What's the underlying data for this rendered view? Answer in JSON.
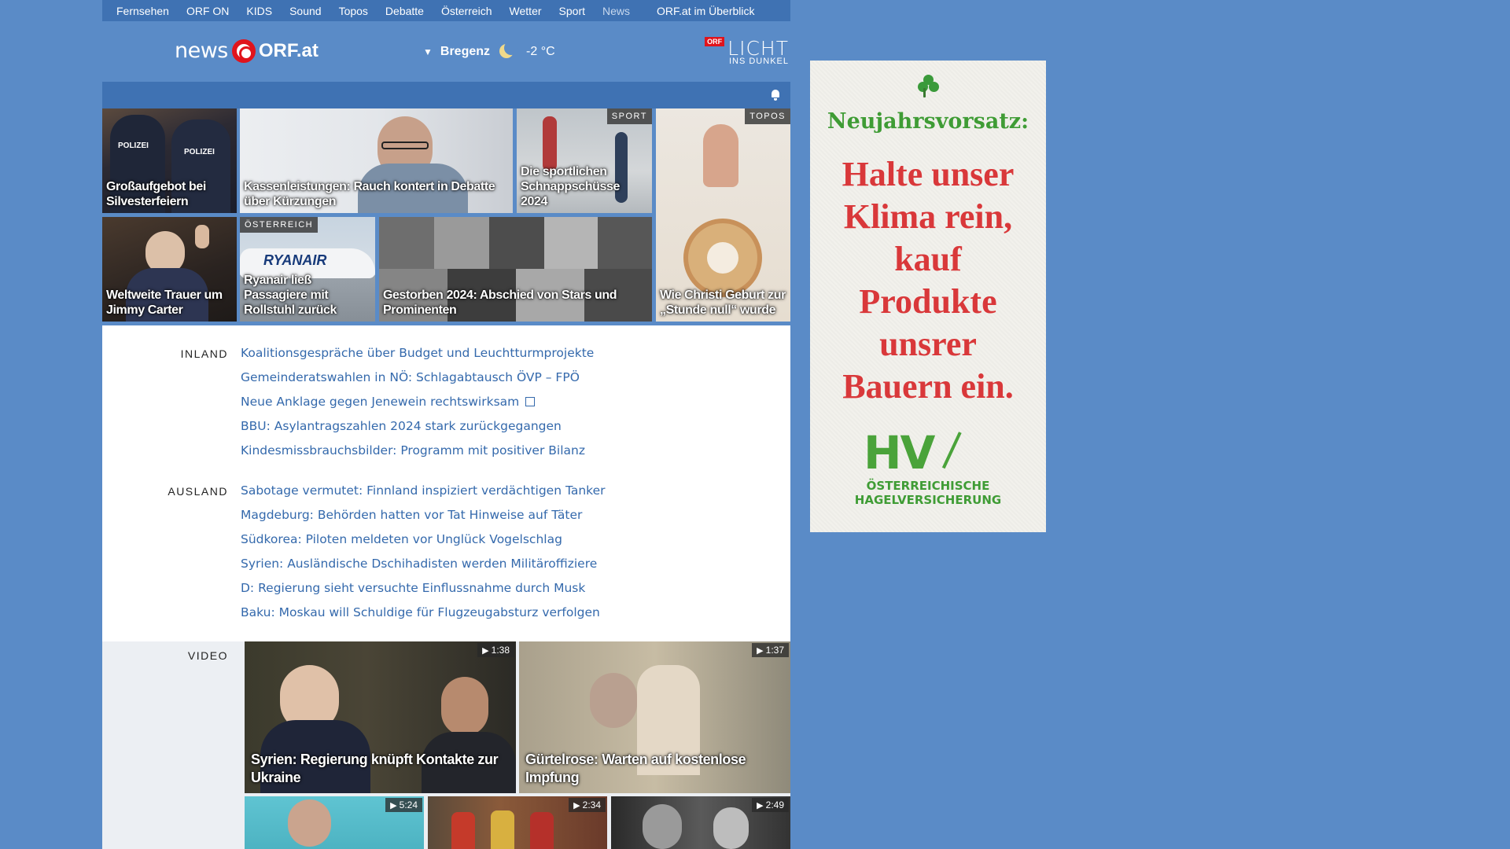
{
  "topnav": {
    "items": [
      "Fernsehen",
      "ORF ON",
      "KIDS",
      "Sound",
      "Topos",
      "Debatte",
      "Österreich",
      "Wetter",
      "Sport",
      "News"
    ],
    "overview": "ORF.at im Überblick"
  },
  "header": {
    "logo_news": "news",
    "logo_orf": "ORF.at",
    "weather_location": "Bregenz",
    "weather_temp": "-2 °C",
    "licht_badge": "ORF",
    "licht_title": "LICHT",
    "licht_subtitle": "INS DUNKEL"
  },
  "tiles": [
    {
      "caption": "Großaufgebot bei Silvesterfeiern",
      "tag": ""
    },
    {
      "caption": "Kassenleistungen: Rauch kontert in Debatte über Kürzungen",
      "tag": ""
    },
    {
      "caption": "Die sportlichen Schnappschüsse 2024",
      "tag": "SPORT"
    },
    {
      "caption": "Wie Christi Geburt zur „Stunde null“ wurde",
      "tag": "TOPOS"
    },
    {
      "caption": "Weltweite Trauer um Jimmy Carter",
      "tag": ""
    },
    {
      "caption": "Ryanair ließ Passagiere mit Rollstuhl zurück",
      "tag": "ÖSTERREICH"
    },
    {
      "caption": "Gestorben 2024: Abschied von Stars und Prominenten",
      "tag": ""
    }
  ],
  "inland": {
    "label": "INLAND",
    "links": [
      "Koalitionsgespräche über Budget und Leuchtturmprojekte",
      "Gemeinderatswahlen in NÖ: Schlagabtausch ÖVP – FPÖ",
      "Neue Anklage gegen Jenewein rechtswirksam",
      "BBU: Asylantragszahlen 2024 stark zurückgegangen",
      "Kindesmissbrauchsbilder: Programm mit positiver Bilanz"
    ]
  },
  "ausland": {
    "label": "AUSLAND",
    "links": [
      "Sabotage vermutet: Finnland inspiziert verdächtigen Tanker",
      "Magdeburg: Behörden hatten vor Tat Hinweise auf Täter",
      "Südkorea: Piloten meldeten vor Unglück Vogelschlag",
      "Syrien: Ausländische Dschihadisten werden Militäroffiziere",
      "D: Regierung sieht versuchte Einflussnahme durch Musk",
      "Baku: Moskau will Schuldige für Flugzeugabsturz verfolgen"
    ]
  },
  "video": {
    "label": "VIDEO",
    "items": [
      {
        "caption": "Syrien: Regierung knüpft Kontakte zur Ukraine",
        "duration": "1:38"
      },
      {
        "caption": "Gürtelrose: Warten auf kostenlose Impfung",
        "duration": "1:37"
      },
      {
        "caption": "",
        "duration": "5:24"
      },
      {
        "caption": "",
        "duration": "2:34"
      },
      {
        "caption": "",
        "duration": "2:49"
      }
    ]
  },
  "ad": {
    "headline": "Neujahrsvorsatz:",
    "body": "Halte unser Klima rein, kauf Produkte unsrer Bauern ein.",
    "logo": "HV",
    "company_line1": "ÖSTERREICHISCHE",
    "company_line2": "HAGELVERSICHERUNG"
  }
}
